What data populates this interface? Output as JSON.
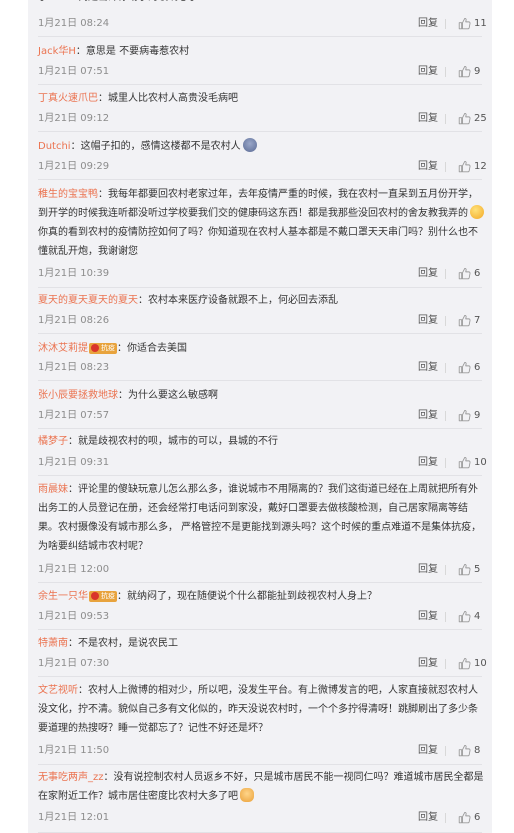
{
  "comments": [
    {
      "user": "",
      "badge": "",
      "text": "了？？？倒是击碎你幼小的玻璃心了...",
      "time": "1月21日 08:24",
      "reply": "回复",
      "likes": "11",
      "emoji": ""
    },
    {
      "user": "Jack华H",
      "badge": "",
      "text": "：意思是 不要病毒惹农村",
      "time": "1月21日 07:51",
      "reply": "回复",
      "likes": "9",
      "emoji": ""
    },
    {
      "user": "丁真火速爪巴",
      "badge": "",
      "text": "：城里人比农村人高贵没毛病吧",
      "time": "1月21日 09:12",
      "reply": "回复",
      "likes": "25",
      "emoji": ""
    },
    {
      "user": "Dutchi",
      "badge": "",
      "text": "：这帽子扣的，感情这楼都不是农村人",
      "time": "1月21日 09:29",
      "reply": "回复",
      "likes": "12",
      "emoji": "person"
    },
    {
      "user": "稚生的宝宝鸭",
      "badge": "",
      "text": "：我每年都要回农村老家过年，去年疫情严重的时候，我在农村一直呆到五月份开学，到开学的时候我连听都没听过学校要我们交的健康码这东西！都是我那些没回农村的舍友教我弄的",
      "text2": "你真的看到农村的疫情防控如何了吗？你知道现在农村人基本都是不戴口罩天天串门吗？别什么也不懂就乱开炮，我谢谢您",
      "time": "1月21日 10:39",
      "reply": "回复",
      "likes": "6",
      "emoji": "face"
    },
    {
      "user": "夏天的夏天夏天的夏天",
      "badge": "",
      "text": "：农村本来医疗设备就跟不上，何必回去添乱",
      "time": "1月21日 08:26",
      "reply": "回复",
      "likes": "7",
      "emoji": ""
    },
    {
      "user": "沐沐艾莉提",
      "badge": "抗疫",
      "text": "：你适合去美国",
      "time": "1月21日 08:23",
      "reply": "回复",
      "likes": "6",
      "emoji": ""
    },
    {
      "user": "张小辰要拯救地球",
      "badge": "",
      "text": "：为什么要这么敏感啊",
      "time": "1月21日 07:57",
      "reply": "回复",
      "likes": "9",
      "emoji": ""
    },
    {
      "user": "橘梦子",
      "badge": "",
      "text": "：就是歧视农村的呗，城市的可以，县城的不行",
      "time": "1月21日 09:31",
      "reply": "回复",
      "likes": "10",
      "emoji": ""
    },
    {
      "user": "雨晨妹",
      "badge": "",
      "text": "：评论里的傻缺玩意儿怎么那么多，谁说城市不用隔离的？我们这街道已经在上周就把所有外出务工的人员登记在册，还会经常打电话问到家没，戴好口罩要去做核酸检测，自己居家隔离等结果。农村摄像没有城市那么多， 严格管控不是更能找到源头吗？这个时候的重点难道不是集体抗疫，为啥要纠结城市农村呢？",
      "time": "1月21日 12:00",
      "reply": "回复",
      "likes": "5",
      "emoji": ""
    },
    {
      "user": "余生一只华",
      "badge": "抗疫",
      "text": "：就纳闷了，现在随便说个什么都能扯到歧视农村人身上？",
      "time": "1月21日 09:53",
      "reply": "回复",
      "likes": "4",
      "emoji": ""
    },
    {
      "user": "特萧南",
      "badge": "",
      "text": "：不是农村，是说农民工",
      "time": "1月21日 07:30",
      "reply": "回复",
      "likes": "10",
      "emoji": ""
    },
    {
      "user": "文艺视听",
      "badge": "",
      "text": "：农村人上微博的相对少，所以吧，没发生平台。有上微博发言的吧，人家直接就怼农村人没文化，拧不清。貌似自己多有文化似的，昨天没说农村时，一个个多拧得清呀！跳脚刷出了多少条要道理的热搜呀？睡一觉都忘了？记性不好还是坏？",
      "time": "1月21日 11:50",
      "reply": "回复",
      "likes": "8",
      "emoji": ""
    },
    {
      "user": "无事吃两声_zz",
      "badge": "",
      "text": "：没有说控制农村人员返乡不好，只是城市居民不能一视同仁吗？难道城市居民全都是在家附近工作？城市居住密度比农村大多了吧",
      "time": "1月21日 12:01",
      "reply": "回复",
      "likes": "6",
      "emoji": "clap"
    }
  ],
  "colors": {
    "username": "#eb7350",
    "time": "#8c8c8c",
    "background": "#f2f2f5"
  },
  "icons": {
    "like": "thumbs-up-icon"
  }
}
